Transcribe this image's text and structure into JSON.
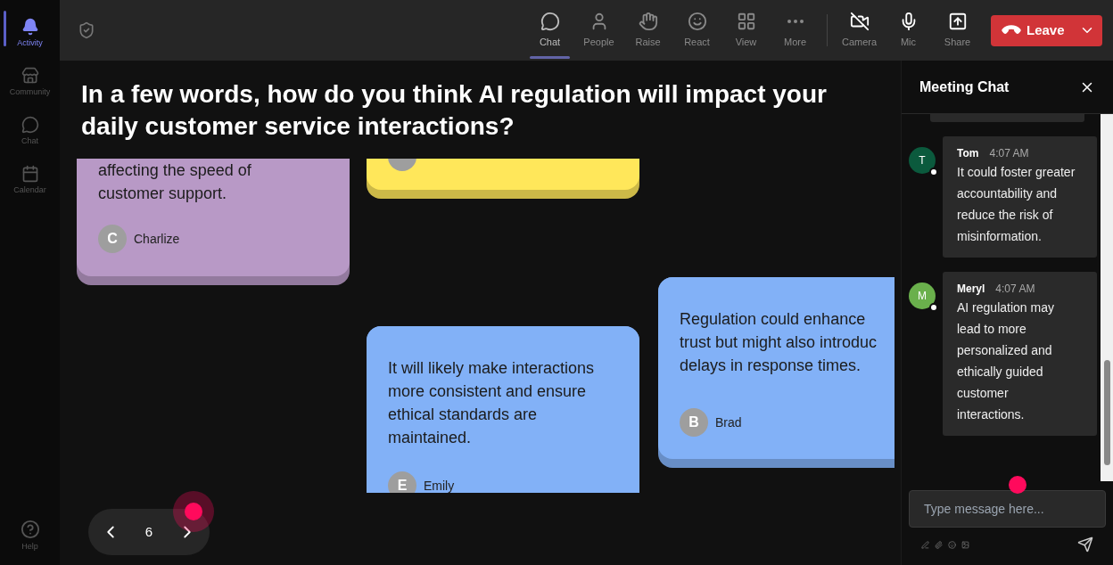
{
  "rail": [
    {
      "label": "Activity",
      "selected": true
    },
    {
      "label": "Community",
      "selected": false
    },
    {
      "label": "Chat",
      "selected": false
    },
    {
      "label": "Calendar",
      "selected": false
    }
  ],
  "help": {
    "label": "Help"
  },
  "toolbar": {
    "items": [
      {
        "label": "Chat",
        "selected": true
      },
      {
        "label": "People",
        "selected": false
      },
      {
        "label": "Raise",
        "selected": false
      },
      {
        "label": "React",
        "selected": false
      },
      {
        "label": "View",
        "selected": false
      },
      {
        "label": "More",
        "selected": false
      }
    ],
    "devices": [
      {
        "label": "Camera"
      },
      {
        "label": "Mic"
      },
      {
        "label": "Share"
      }
    ],
    "leave": {
      "label": "Leave"
    }
  },
  "question": "In a few words, how do you think AI regulation will impact your daily customer service interactions?",
  "notes": [
    {
      "color": "#b899c6",
      "lines": [
        "affecting the speed of",
        "customer support."
      ],
      "initial": "C",
      "author": "Charlize"
    },
    {
      "color": "#ffe75a"
    },
    {
      "color": "#82b1f7",
      "lines": [
        "It will likely make interactions",
        "more consistent and ensure",
        "ethical standards are",
        "maintained."
      ],
      "initial": "E",
      "author": "Emily"
    },
    {
      "color": "#82b1f7",
      "lines": [
        "Regulation could enhance",
        "trust but might also introduc",
        "delays in response times."
      ],
      "initial": "B",
      "author": "Brad"
    }
  ],
  "pager": {
    "page": "6"
  },
  "chat": {
    "title": "Meeting Chat",
    "messages": [
      {
        "initial": "T",
        "color": "#0b5a3d",
        "name": "Tom",
        "time": "4:07 AM",
        "text": "It could foster greater accountability and reduce the risk of misinformation."
      },
      {
        "initial": "M",
        "color": "#6ab04c",
        "name": "Meryl",
        "time": "4:07 AM",
        "text": "AI regulation may lead to more personalized and ethically guided customer interactions."
      }
    ],
    "placeholder": "Type message here..."
  }
}
